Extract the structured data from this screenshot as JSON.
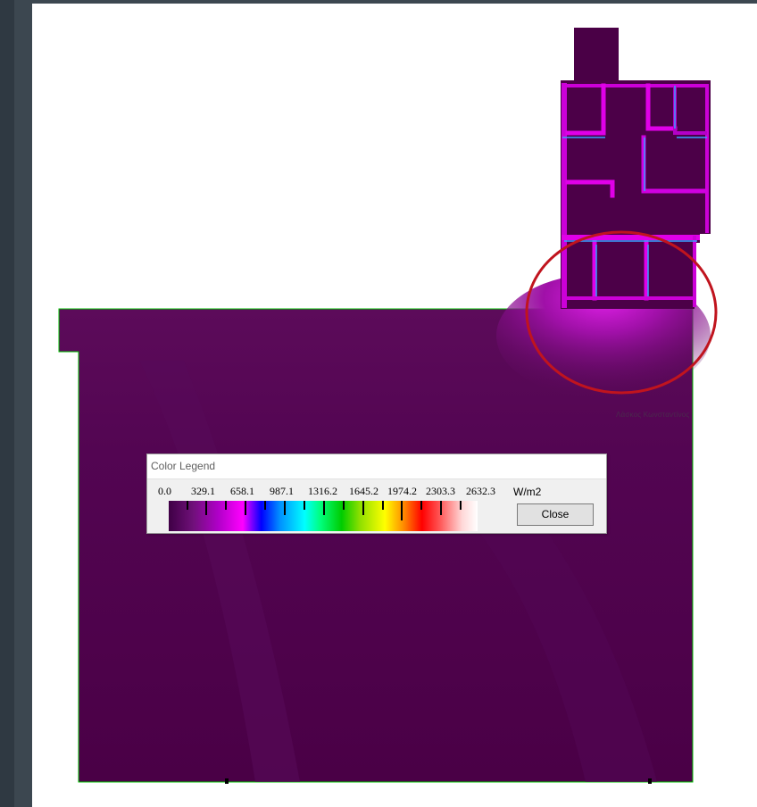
{
  "viewer": {
    "author_text": "Λάσκος Κωνσταντίνος",
    "highlight_color": "#c0141e"
  },
  "legend": {
    "title": "Color Legend",
    "tick_labels": [
      "0.0",
      "329.1",
      "658.1",
      "987.1",
      "1316.2",
      "1645.2",
      "1974.2",
      "2303.3",
      "2632.3"
    ],
    "unit": "W/m2",
    "close_label": "Close"
  },
  "colors": {
    "floor_dark": "#4a0044",
    "floor_mid": "#5a0a5a",
    "hot_spot": "#d400d8",
    "wall_edge": "#00ff00",
    "highlight_circle": "#c0141e"
  },
  "icons": {
    "close": "close-icon"
  }
}
